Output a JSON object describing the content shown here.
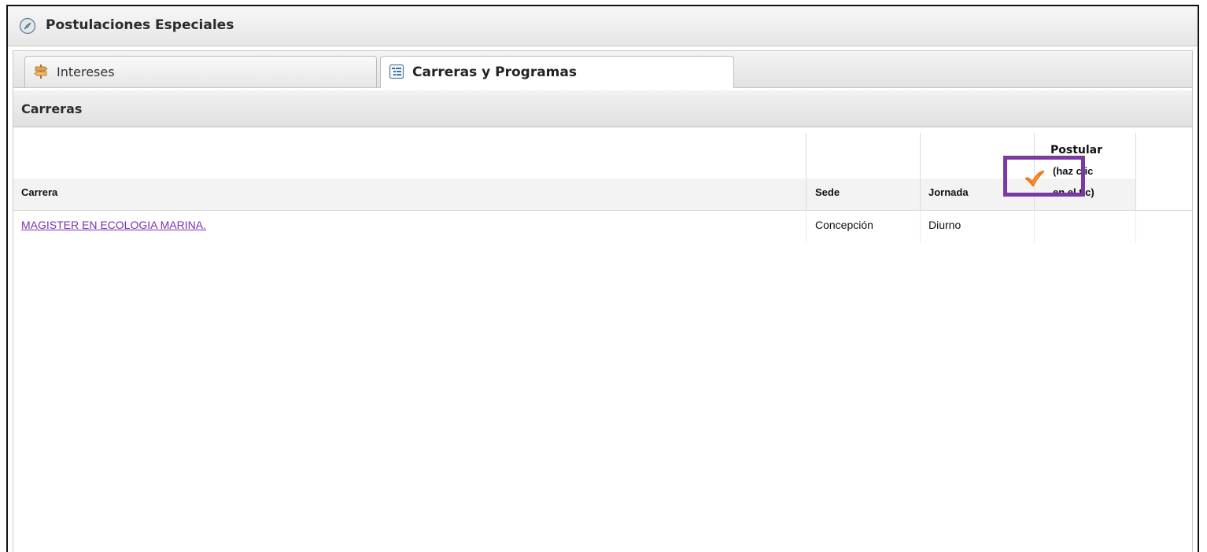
{
  "panel": {
    "title": "Postulaciones Especiales",
    "icon": "compass-icon"
  },
  "tabs": [
    {
      "label": "Intereses",
      "icon": "signpost-icon",
      "active": false
    },
    {
      "label": "Carreras y Programas",
      "icon": "tree-list-icon",
      "active": true
    }
  ],
  "section": {
    "title": "Carreras"
  },
  "table": {
    "headers": {
      "carrera": "Carrera",
      "sede": "Sede",
      "jornada": "Jornada",
      "postular_line1": "Postular",
      "postular_line2": "(haz clic",
      "postular_line3": "en el tic)"
    },
    "rows": [
      {
        "carrera": "MAGISTER EN ECOLOGIA MARINA.",
        "sede": "Concepción",
        "jornada": "Diurno",
        "postular_icon": "checkmark-icon"
      }
    ]
  },
  "colors": {
    "link": "#7a2fb0",
    "highlight": "#7b3aa3",
    "tick": "#f07a1a"
  }
}
